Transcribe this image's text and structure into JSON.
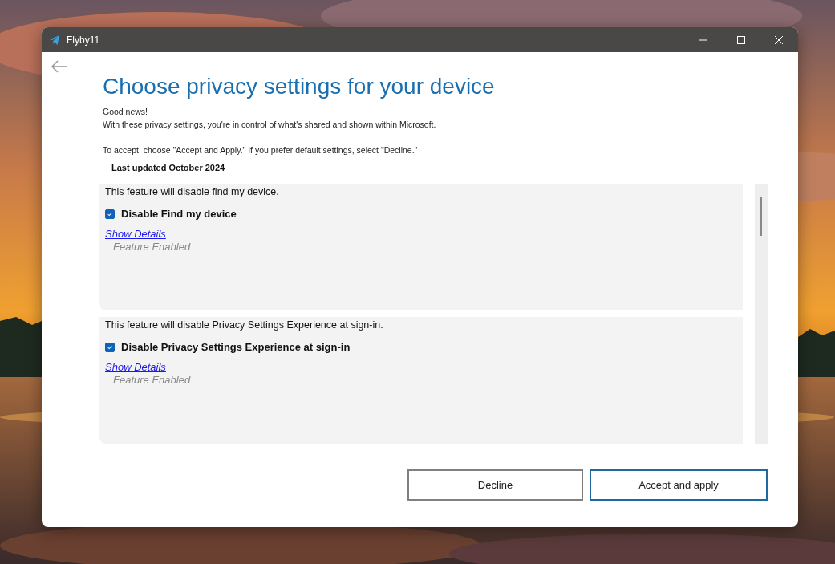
{
  "window": {
    "title": "Flyby11"
  },
  "heading": "Choose privacy settings for your device",
  "intro": [
    [
      "Good news!",
      "With these privacy settings, you're in control of what's shared and shown within Microsoft."
    ],
    [
      "To accept, choose \"Accept and Apply.\" If you prefer default settings, select \"Decline.\""
    ]
  ],
  "last_updated": "Last updated October 2024",
  "features": [
    {
      "description": "This feature will disable find my device.",
      "label": "Disable Find my device",
      "checked": true,
      "link": "Show Details",
      "status": "Feature Enabled"
    },
    {
      "description": "This feature will disable Privacy Settings Experience at sign-in.",
      "label": "Disable Privacy Settings Experience at sign-in",
      "checked": true,
      "link": "Show Details",
      "status": "Feature Enabled"
    }
  ],
  "buttons": [
    {
      "label": "Decline",
      "kind": "secondary"
    },
    {
      "label": "Accept and apply",
      "kind": "primary"
    }
  ]
}
